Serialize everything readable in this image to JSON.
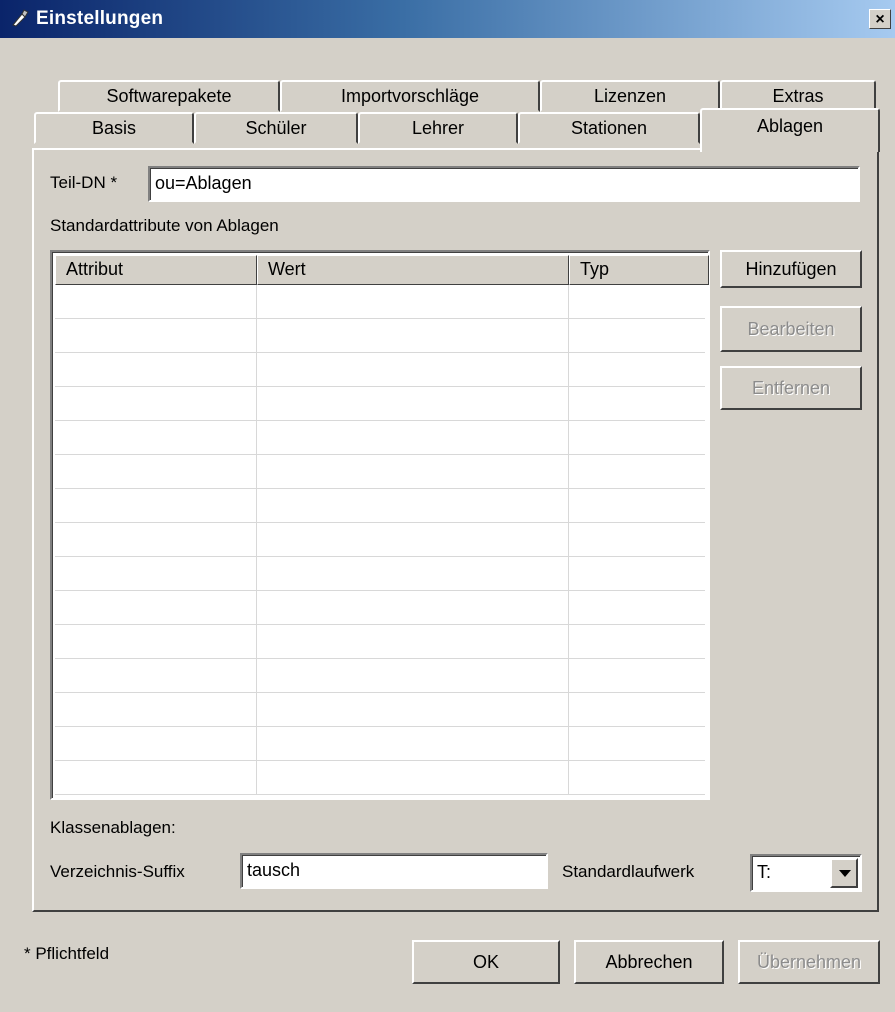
{
  "window": {
    "title": "Einstellungen",
    "close_label": "×"
  },
  "tabs": {
    "row1": [
      "Softwarepakete",
      "Importvorschläge",
      "Lizenzen",
      "Extras"
    ],
    "row2": [
      "Basis",
      "Schüler",
      "Lehrer",
      "Stationen",
      "Ablagen"
    ],
    "active": "Ablagen"
  },
  "form": {
    "teil_dn_label": "Teil-DN *",
    "teil_dn_value": "ou=Ablagen",
    "section_label": "Standardattribute von Ablagen",
    "table": {
      "columns": [
        "Attribut",
        "Wert",
        "Typ"
      ],
      "rows": []
    },
    "buttons": {
      "add": "Hinzufügen",
      "edit": "Bearbeiten",
      "remove": "Entfernen"
    },
    "klassenablagen_label": "Klassenablagen:",
    "suffix_label": "Verzeichnis-Suffix",
    "suffix_value": "tausch",
    "drive_label": "Standardlaufwerk",
    "drive_value": "T:"
  },
  "footer": {
    "required_note": "* Pflichtfeld",
    "ok": "OK",
    "cancel": "Abbrechen",
    "apply": "Übernehmen"
  }
}
